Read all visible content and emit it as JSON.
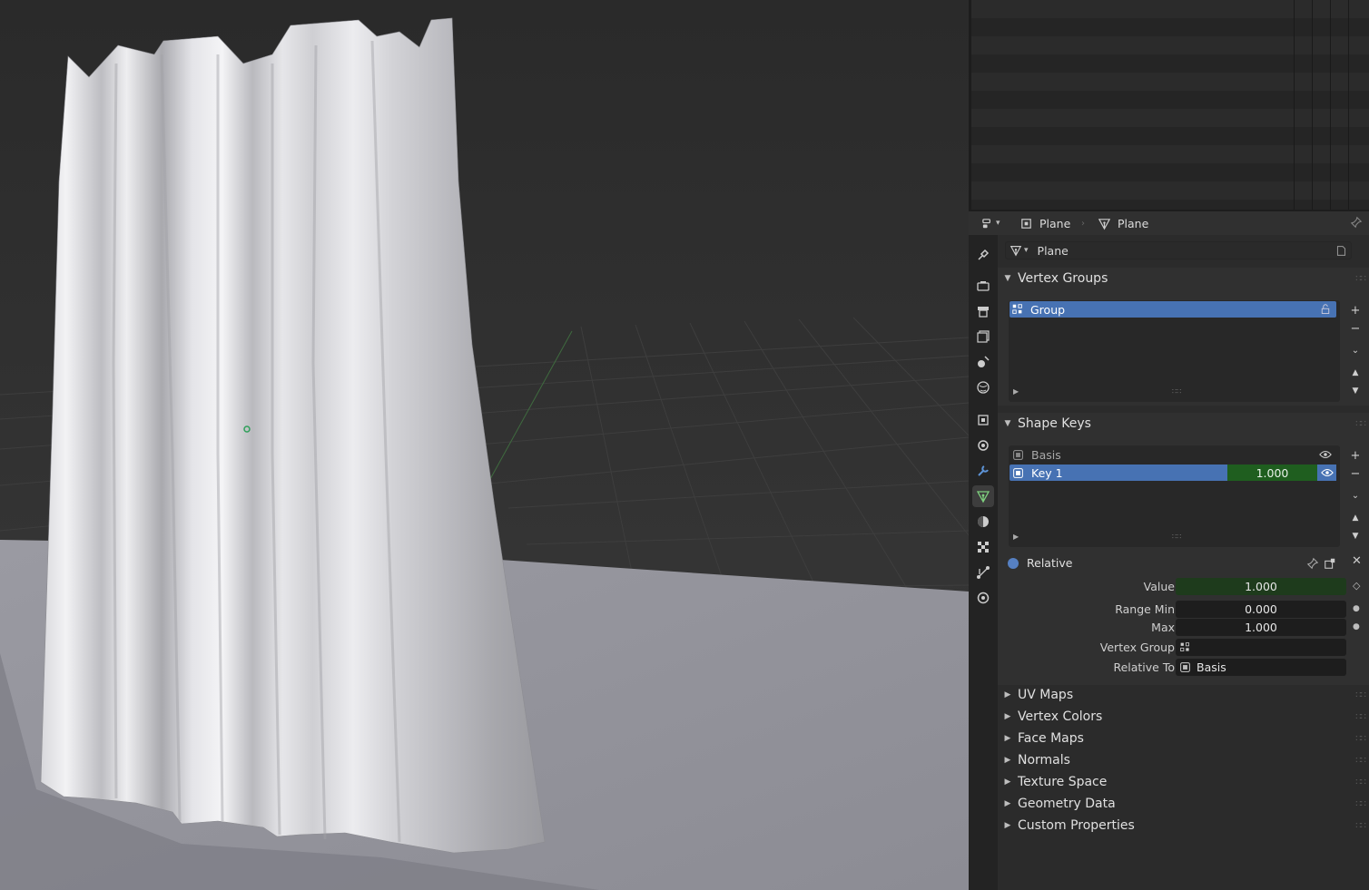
{
  "header": {
    "object_name": "Plane",
    "mesh_name": "Plane"
  },
  "datablock": {
    "name": "Plane"
  },
  "vertex_groups": {
    "title": "Vertex Groups",
    "items": [
      {
        "name": "Group",
        "selected": true
      }
    ]
  },
  "shape_keys": {
    "title": "Shape Keys",
    "items": [
      {
        "name": "Basis",
        "selected": false,
        "value": ""
      },
      {
        "name": "Key 1",
        "selected": true,
        "value": "1.000"
      }
    ],
    "relative_label": "Relative"
  },
  "key_props": {
    "value_label": "Value",
    "value": "1.000",
    "range_min_label": "Range Min",
    "range_min": "0.000",
    "max_label": "Max",
    "max": "1.000",
    "vertex_group_label": "Vertex Group",
    "vertex_group": "",
    "relative_to_label": "Relative To",
    "relative_to": "Basis"
  },
  "collapsed_panels": [
    "UV Maps",
    "Vertex Colors",
    "Face Maps",
    "Normals",
    "Texture Space",
    "Geometry Data",
    "Custom Properties"
  ],
  "colors": {
    "selection": "#4772b3",
    "value_field": "#1e3b1c",
    "accent_green": "#1f5e1f"
  },
  "icons": [
    "editor-type-icon",
    "object-icon",
    "mesh-icon",
    "pin-icon",
    "tool-icon",
    "render-icon",
    "output-icon",
    "view-layer-icon",
    "scene-icon",
    "world-icon",
    "object-props-icon",
    "modifier-icon",
    "particles-icon",
    "physics-icon",
    "constraints-icon",
    "data-icon",
    "material-icon",
    "texture-icon",
    "plus-icon",
    "minus-icon",
    "chevron-down-icon",
    "arrow-up-icon",
    "arrow-down-icon",
    "eye-icon",
    "keyframe-icon",
    "close-icon"
  ]
}
